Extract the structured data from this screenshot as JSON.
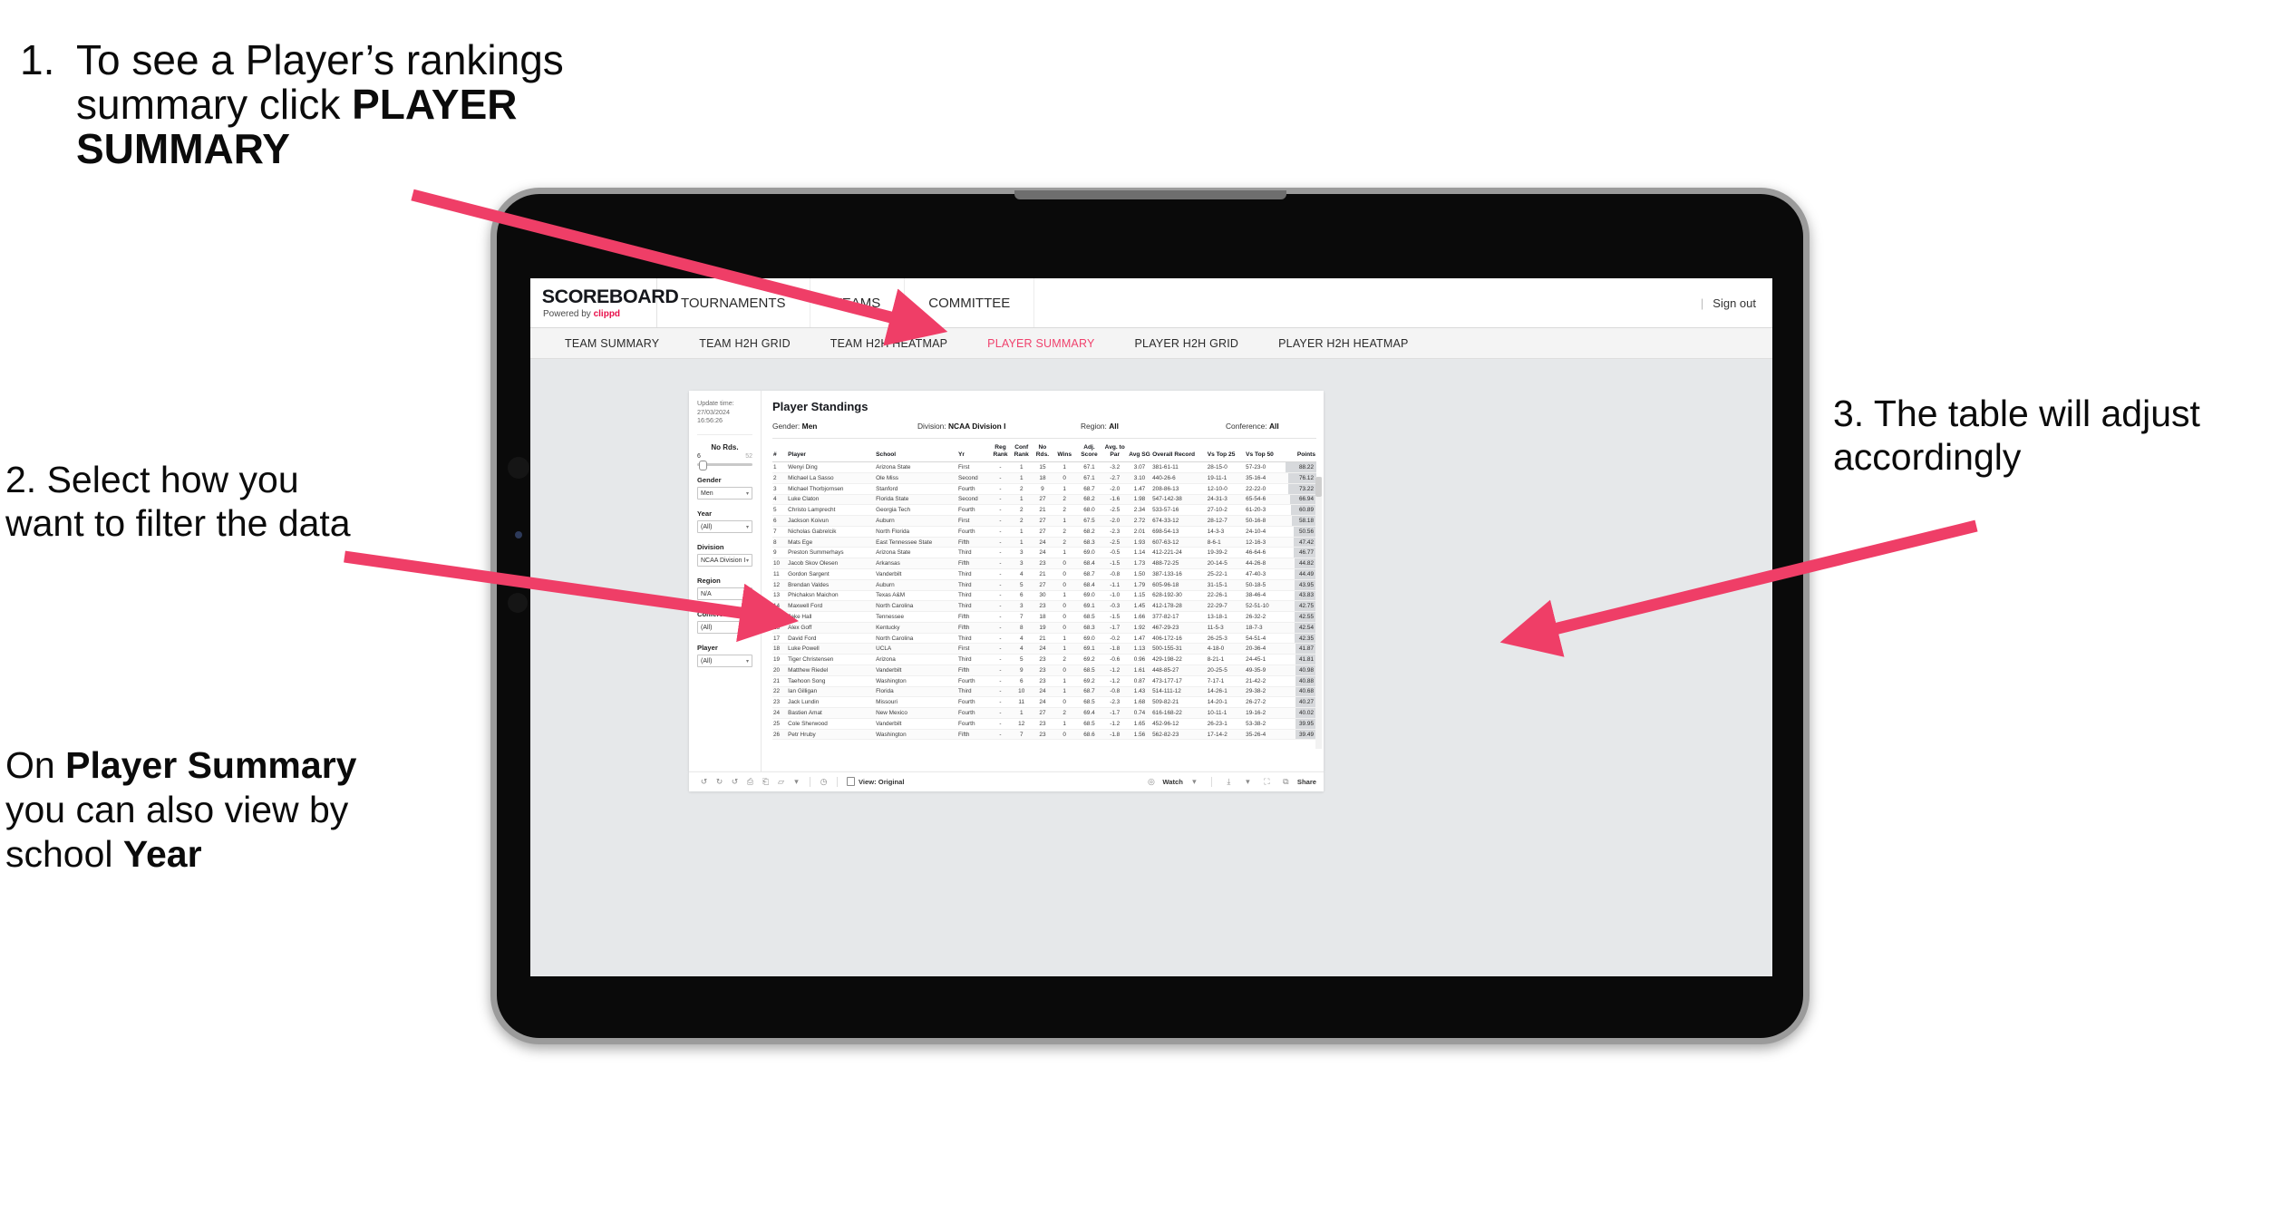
{
  "annotations": {
    "one": {
      "number": "1.",
      "text_plain_a": "To see a Player’s rankings summary click ",
      "text_bold": "PLAYER SUMMARY"
    },
    "two": {
      "text": "2. Select how you want to filter the data"
    },
    "three": {
      "text": "3. The table will adjust accordingly"
    },
    "four": {
      "prefix": "On ",
      "bold1": "Player Summary",
      "mid": " you can also view by school ",
      "bold2": "Year"
    }
  },
  "app": {
    "logo_word": "SCOREBOARD",
    "logo_sub_prefix": "Powered by ",
    "logo_sub_brand": "clippd",
    "top_nav": [
      "TOURNAMENTS",
      "TEAMS",
      "COMMITTEE"
    ],
    "account_sep": "|",
    "sign_out": "Sign out",
    "sub_nav": [
      {
        "label": "TEAM SUMMARY",
        "active": false
      },
      {
        "label": "TEAM H2H GRID",
        "active": false
      },
      {
        "label": "TEAM H2H HEATMAP",
        "active": false
      },
      {
        "label": "PLAYER SUMMARY",
        "active": true
      },
      {
        "label": "PLAYER H2H GRID",
        "active": false
      },
      {
        "label": "PLAYER H2H HEATMAP",
        "active": false
      }
    ],
    "accent_color": "#f0426d",
    "brand_red": "#e8114b"
  },
  "sidebar": {
    "update_label": "Update time:",
    "update_value": "27/03/2024 16:56:26",
    "slider": {
      "label": "No Rds.",
      "min": "6",
      "max": "52"
    },
    "filters": [
      {
        "label": "Gender",
        "value": "Men"
      },
      {
        "label": "Year",
        "value": "(All)"
      },
      {
        "label": "Division",
        "value": "NCAA Division I"
      },
      {
        "label": "Region",
        "value": "N/A"
      },
      {
        "label": "Conference",
        "value": "(All)"
      },
      {
        "label": "Player",
        "value": "(All)"
      }
    ]
  },
  "report": {
    "title": "Player Standings",
    "meta": [
      {
        "label": "Gender:",
        "value": "Men"
      },
      {
        "label": "Division:",
        "value": "NCAA Division I"
      },
      {
        "label": "Region:",
        "value": "All"
      },
      {
        "label": "Conference:",
        "value": "All"
      }
    ],
    "columns": [
      {
        "key": "num",
        "label": "#"
      },
      {
        "key": "player",
        "label": "Player"
      },
      {
        "key": "school",
        "label": "School"
      },
      {
        "key": "yr",
        "label": "Yr"
      },
      {
        "key": "reg_rank",
        "label": "Reg Rank"
      },
      {
        "key": "conf_rank",
        "label": "Conf Rank"
      },
      {
        "key": "no_rds",
        "label": "No Rds."
      },
      {
        "key": "wins",
        "label": "Wins"
      },
      {
        "key": "adj_score",
        "label": "Adj. Score"
      },
      {
        "key": "avg_to_par",
        "label": "Avg. to Par"
      },
      {
        "key": "avg_sg",
        "label": "Avg SG"
      },
      {
        "key": "overall_record",
        "label": "Overall Record"
      },
      {
        "key": "vs_top25",
        "label": "Vs Top 25"
      },
      {
        "key": "vs_top50",
        "label": "Vs Top 50"
      },
      {
        "key": "points",
        "label": "Points"
      }
    ],
    "rows": [
      {
        "num": "1",
        "player": "Wenyi Ding",
        "school": "Arizona State",
        "yr": "First",
        "reg_rank": "-",
        "conf_rank": "1",
        "no_rds": "15",
        "wins": "1",
        "adj_score": "67.1",
        "avg_to_par": "-3.2",
        "avg_sg": "3.07",
        "overall_record": "381-61-11",
        "vs_top25": "28-15-0",
        "vs_top50": "57-23-0",
        "points": "88.22"
      },
      {
        "num": "2",
        "player": "Michael La Sasso",
        "school": "Ole Miss",
        "yr": "Second",
        "reg_rank": "-",
        "conf_rank": "1",
        "no_rds": "18",
        "wins": "0",
        "adj_score": "67.1",
        "avg_to_par": "-2.7",
        "avg_sg": "3.10",
        "overall_record": "440-26-6",
        "vs_top25": "19-11-1",
        "vs_top50": "35-16-4",
        "points": "76.12"
      },
      {
        "num": "3",
        "player": "Michael Thorbjornsen",
        "school": "Stanford",
        "yr": "Fourth",
        "reg_rank": "-",
        "conf_rank": "2",
        "no_rds": "9",
        "wins": "1",
        "adj_score": "68.7",
        "avg_to_par": "-2.0",
        "avg_sg": "1.47",
        "overall_record": "208-86-13",
        "vs_top25": "12-10-0",
        "vs_top50": "22-22-0",
        "points": "73.22"
      },
      {
        "num": "4",
        "player": "Luke Claton",
        "school": "Florida State",
        "yr": "Second",
        "reg_rank": "-",
        "conf_rank": "1",
        "no_rds": "27",
        "wins": "2",
        "adj_score": "68.2",
        "avg_to_par": "-1.6",
        "avg_sg": "1.98",
        "overall_record": "547-142-38",
        "vs_top25": "24-31-3",
        "vs_top50": "65-54-6",
        "points": "66.94"
      },
      {
        "num": "5",
        "player": "Christo Lamprecht",
        "school": "Georgia Tech",
        "yr": "Fourth",
        "reg_rank": "-",
        "conf_rank": "2",
        "no_rds": "21",
        "wins": "2",
        "adj_score": "68.0",
        "avg_to_par": "-2.5",
        "avg_sg": "2.34",
        "overall_record": "533-57-16",
        "vs_top25": "27-10-2",
        "vs_top50": "61-20-3",
        "points": "60.89"
      },
      {
        "num": "6",
        "player": "Jackson Koivun",
        "school": "Auburn",
        "yr": "First",
        "reg_rank": "-",
        "conf_rank": "2",
        "no_rds": "27",
        "wins": "1",
        "adj_score": "67.5",
        "avg_to_par": "-2.0",
        "avg_sg": "2.72",
        "overall_record": "674-33-12",
        "vs_top25": "28-12-7",
        "vs_top50": "50-16-8",
        "points": "58.18"
      },
      {
        "num": "7",
        "player": "Nicholas Gabrelcik",
        "school": "North Florida",
        "yr": "Fourth",
        "reg_rank": "-",
        "conf_rank": "1",
        "no_rds": "27",
        "wins": "2",
        "adj_score": "68.2",
        "avg_to_par": "-2.3",
        "avg_sg": "2.01",
        "overall_record": "698-54-13",
        "vs_top25": "14-3-3",
        "vs_top50": "24-10-4",
        "points": "50.56"
      },
      {
        "num": "8",
        "player": "Mats Ege",
        "school": "East Tennessee State",
        "yr": "Fifth",
        "reg_rank": "-",
        "conf_rank": "1",
        "no_rds": "24",
        "wins": "2",
        "adj_score": "68.3",
        "avg_to_par": "-2.5",
        "avg_sg": "1.93",
        "overall_record": "607-63-12",
        "vs_top25": "8-6-1",
        "vs_top50": "12-16-3",
        "points": "47.42"
      },
      {
        "num": "9",
        "player": "Preston Summerhays",
        "school": "Arizona State",
        "yr": "Third",
        "reg_rank": "-",
        "conf_rank": "3",
        "no_rds": "24",
        "wins": "1",
        "adj_score": "69.0",
        "avg_to_par": "-0.5",
        "avg_sg": "1.14",
        "overall_record": "412-221-24",
        "vs_top25": "19-39-2",
        "vs_top50": "46-64-6",
        "points": "46.77"
      },
      {
        "num": "10",
        "player": "Jacob Skov Olesen",
        "school": "Arkansas",
        "yr": "Fifth",
        "reg_rank": "-",
        "conf_rank": "3",
        "no_rds": "23",
        "wins": "0",
        "adj_score": "68.4",
        "avg_to_par": "-1.5",
        "avg_sg": "1.73",
        "overall_record": "488-72-25",
        "vs_top25": "20-14-5",
        "vs_top50": "44-26-8",
        "points": "44.82"
      },
      {
        "num": "11",
        "player": "Gordon Sargent",
        "school": "Vanderbilt",
        "yr": "Third",
        "reg_rank": "-",
        "conf_rank": "4",
        "no_rds": "21",
        "wins": "0",
        "adj_score": "68.7",
        "avg_to_par": "-0.8",
        "avg_sg": "1.50",
        "overall_record": "387-133-16",
        "vs_top25": "25-22-1",
        "vs_top50": "47-40-3",
        "points": "44.49"
      },
      {
        "num": "12",
        "player": "Brendan Valdes",
        "school": "Auburn",
        "yr": "Third",
        "reg_rank": "-",
        "conf_rank": "5",
        "no_rds": "27",
        "wins": "0",
        "adj_score": "68.4",
        "avg_to_par": "-1.1",
        "avg_sg": "1.79",
        "overall_record": "605-96-18",
        "vs_top25": "31-15-1",
        "vs_top50": "50-18-5",
        "points": "43.95"
      },
      {
        "num": "13",
        "player": "Phichaksn Maichon",
        "school": "Texas A&M",
        "yr": "Third",
        "reg_rank": "-",
        "conf_rank": "6",
        "no_rds": "30",
        "wins": "1",
        "adj_score": "69.0",
        "avg_to_par": "-1.0",
        "avg_sg": "1.15",
        "overall_record": "628-192-30",
        "vs_top25": "22-26-1",
        "vs_top50": "38-46-4",
        "points": "43.83"
      },
      {
        "num": "14",
        "player": "Maxwell Ford",
        "school": "North Carolina",
        "yr": "Third",
        "reg_rank": "-",
        "conf_rank": "3",
        "no_rds": "23",
        "wins": "0",
        "adj_score": "69.1",
        "avg_to_par": "-0.3",
        "avg_sg": "1.45",
        "overall_record": "412-178-28",
        "vs_top25": "22-29-7",
        "vs_top50": "52-51-10",
        "points": "42.75"
      },
      {
        "num": "15",
        "player": "Jake Hall",
        "school": "Tennessee",
        "yr": "Fifth",
        "reg_rank": "-",
        "conf_rank": "7",
        "no_rds": "18",
        "wins": "0",
        "adj_score": "68.5",
        "avg_to_par": "-1.5",
        "avg_sg": "1.66",
        "overall_record": "377-82-17",
        "vs_top25": "13-18-1",
        "vs_top50": "26-32-2",
        "points": "42.55"
      },
      {
        "num": "16",
        "player": "Alex Goff",
        "school": "Kentucky",
        "yr": "Fifth",
        "reg_rank": "-",
        "conf_rank": "8",
        "no_rds": "19",
        "wins": "0",
        "adj_score": "68.3",
        "avg_to_par": "-1.7",
        "avg_sg": "1.92",
        "overall_record": "467-29-23",
        "vs_top25": "11-5-3",
        "vs_top50": "18-7-3",
        "points": "42.54"
      },
      {
        "num": "17",
        "player": "David Ford",
        "school": "North Carolina",
        "yr": "Third",
        "reg_rank": "-",
        "conf_rank": "4",
        "no_rds": "21",
        "wins": "1",
        "adj_score": "69.0",
        "avg_to_par": "-0.2",
        "avg_sg": "1.47",
        "overall_record": "406-172-16",
        "vs_top25": "26-25-3",
        "vs_top50": "54-51-4",
        "points": "42.35"
      },
      {
        "num": "18",
        "player": "Luke Powell",
        "school": "UCLA",
        "yr": "First",
        "reg_rank": "-",
        "conf_rank": "4",
        "no_rds": "24",
        "wins": "1",
        "adj_score": "69.1",
        "avg_to_par": "-1.8",
        "avg_sg": "1.13",
        "overall_record": "500-155-31",
        "vs_top25": "4-18-0",
        "vs_top50": "20-36-4",
        "points": "41.87"
      },
      {
        "num": "19",
        "player": "Tiger Christensen",
        "school": "Arizona",
        "yr": "Third",
        "reg_rank": "-",
        "conf_rank": "5",
        "no_rds": "23",
        "wins": "2",
        "adj_score": "69.2",
        "avg_to_par": "-0.6",
        "avg_sg": "0.96",
        "overall_record": "429-198-22",
        "vs_top25": "8-21-1",
        "vs_top50": "24-45-1",
        "points": "41.81"
      },
      {
        "num": "20",
        "player": "Matthew Riedel",
        "school": "Vanderbilt",
        "yr": "Fifth",
        "reg_rank": "-",
        "conf_rank": "9",
        "no_rds": "23",
        "wins": "0",
        "adj_score": "68.5",
        "avg_to_par": "-1.2",
        "avg_sg": "1.61",
        "overall_record": "448-85-27",
        "vs_top25": "20-25-5",
        "vs_top50": "49-35-9",
        "points": "40.98"
      },
      {
        "num": "21",
        "player": "Taehoon Song",
        "school": "Washington",
        "yr": "Fourth",
        "reg_rank": "-",
        "conf_rank": "6",
        "no_rds": "23",
        "wins": "1",
        "adj_score": "69.2",
        "avg_to_par": "-1.2",
        "avg_sg": "0.87",
        "overall_record": "473-177-17",
        "vs_top25": "7-17-1",
        "vs_top50": "21-42-2",
        "points": "40.88"
      },
      {
        "num": "22",
        "player": "Ian Gilligan",
        "school": "Florida",
        "yr": "Third",
        "reg_rank": "-",
        "conf_rank": "10",
        "no_rds": "24",
        "wins": "1",
        "adj_score": "68.7",
        "avg_to_par": "-0.8",
        "avg_sg": "1.43",
        "overall_record": "514-111-12",
        "vs_top25": "14-26-1",
        "vs_top50": "29-38-2",
        "points": "40.68"
      },
      {
        "num": "23",
        "player": "Jack Lundin",
        "school": "Missouri",
        "yr": "Fourth",
        "reg_rank": "-",
        "conf_rank": "11",
        "no_rds": "24",
        "wins": "0",
        "adj_score": "68.5",
        "avg_to_par": "-2.3",
        "avg_sg": "1.68",
        "overall_record": "509-82-21",
        "vs_top25": "14-20-1",
        "vs_top50": "26-27-2",
        "points": "40.27"
      },
      {
        "num": "24",
        "player": "Bastien Amat",
        "school": "New Mexico",
        "yr": "Fourth",
        "reg_rank": "-",
        "conf_rank": "1",
        "no_rds": "27",
        "wins": "2",
        "adj_score": "69.4",
        "avg_to_par": "-1.7",
        "avg_sg": "0.74",
        "overall_record": "616-168-22",
        "vs_top25": "10-11-1",
        "vs_top50": "19-16-2",
        "points": "40.02"
      },
      {
        "num": "25",
        "player": "Cole Sherwood",
        "school": "Vanderbilt",
        "yr": "Fourth",
        "reg_rank": "-",
        "conf_rank": "12",
        "no_rds": "23",
        "wins": "1",
        "adj_score": "68.5",
        "avg_to_par": "-1.2",
        "avg_sg": "1.65",
        "overall_record": "452-96-12",
        "vs_top25": "26-23-1",
        "vs_top50": "53-38-2",
        "points": "39.95"
      },
      {
        "num": "26",
        "player": "Petr Hruby",
        "school": "Washington",
        "yr": "Fifth",
        "reg_rank": "-",
        "conf_rank": "7",
        "no_rds": "23",
        "wins": "0",
        "adj_score": "68.6",
        "avg_to_par": "-1.8",
        "avg_sg": "1.56",
        "overall_record": "562-82-23",
        "vs_top25": "17-14-2",
        "vs_top50": "35-26-4",
        "points": "39.49"
      }
    ]
  },
  "toolbar": {
    "view_label": "View: Original",
    "watch_label": "Watch",
    "share_label": "Share"
  }
}
